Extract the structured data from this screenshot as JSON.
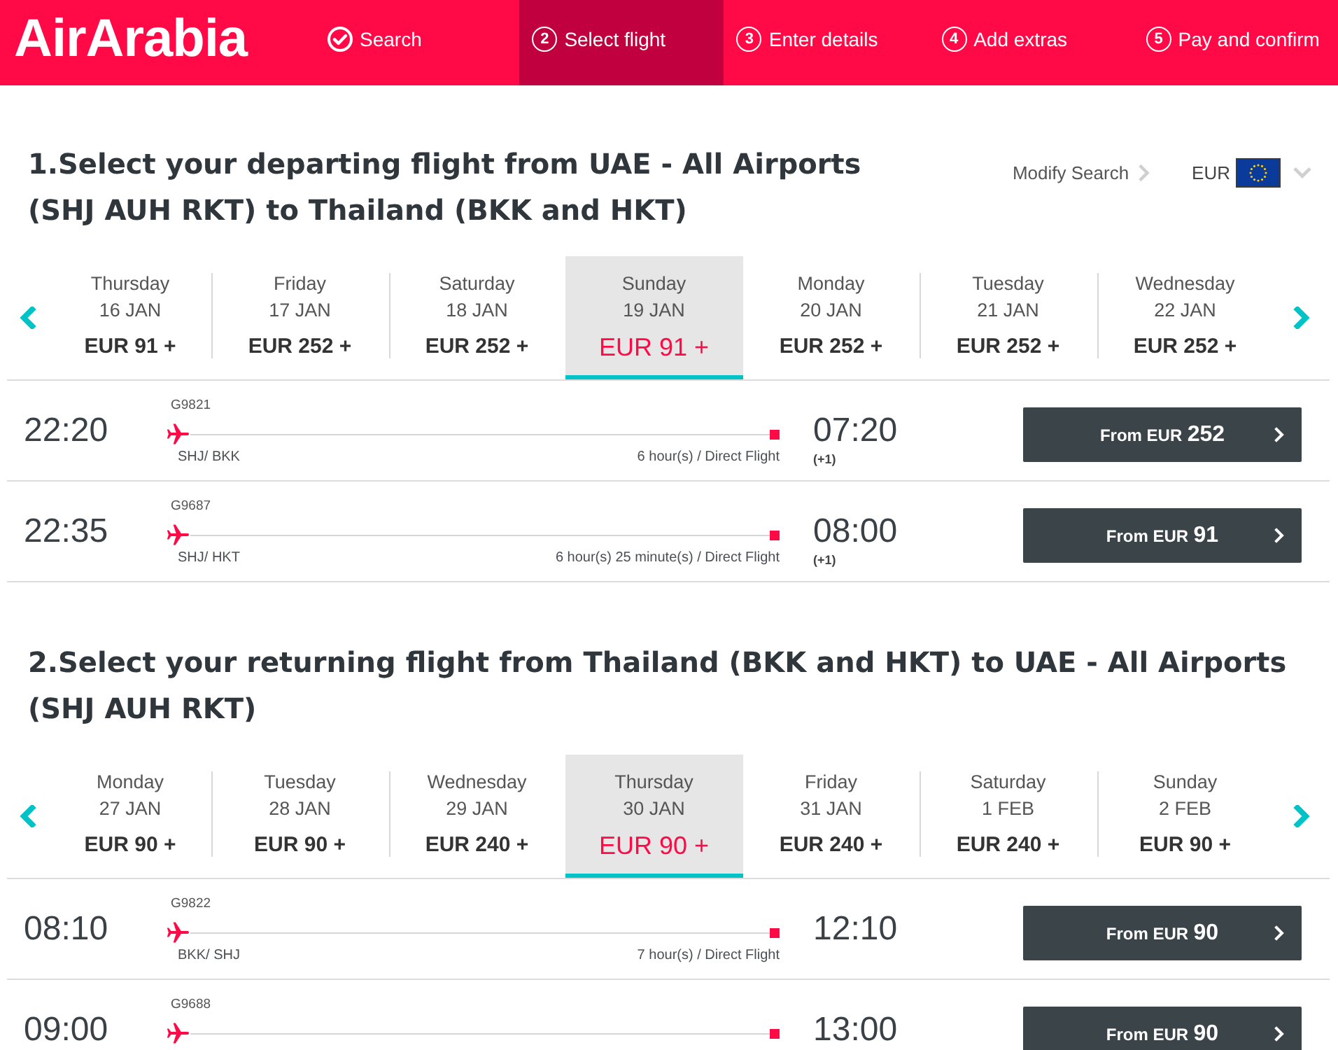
{
  "header": {
    "logo": "AirArabia",
    "steps": [
      {
        "label": "Search",
        "completed": true,
        "selected": false
      },
      {
        "number": "2",
        "label": "Select flight",
        "completed": false,
        "selected": true
      },
      {
        "number": "3",
        "label": "Enter details",
        "completed": false,
        "selected": false
      },
      {
        "number": "4",
        "label": "Add extras",
        "completed": false,
        "selected": false
      },
      {
        "number": "5",
        "label": "Pay and confirm",
        "completed": false,
        "selected": false
      }
    ]
  },
  "sections": [
    {
      "title": "1.Select your departing flight from UAE - All Airports (SHJ AUH RKT) to Thailand (BKK and HKT)",
      "modify_search": "Modify Search",
      "currency": "EUR",
      "dates": [
        {
          "day": "Thursday",
          "date": "16 JAN",
          "price": "EUR 91 +",
          "selected": false
        },
        {
          "day": "Friday",
          "date": "17 JAN",
          "price": "EUR 252 +",
          "selected": false
        },
        {
          "day": "Saturday",
          "date": "18 JAN",
          "price": "EUR 252 +",
          "selected": false
        },
        {
          "day": "Sunday",
          "date": "19 JAN",
          "price": "EUR 91 +",
          "selected": true
        },
        {
          "day": "Monday",
          "date": "20 JAN",
          "price": "EUR 252 +",
          "selected": false
        },
        {
          "day": "Tuesday",
          "date": "21 JAN",
          "price": "EUR 252 +",
          "selected": false
        },
        {
          "day": "Wednesday",
          "date": "22 JAN",
          "price": "EUR 252 +",
          "selected": false
        }
      ],
      "flights": [
        {
          "depart": "22:20",
          "flight_no": "G9821",
          "route": "SHJ/ BKK",
          "duration": "6 hour(s) / Direct Flight",
          "arrive": "07:20",
          "next_day": "(+1)",
          "fare_prefix": "From EUR",
          "fare_amount": "252"
        },
        {
          "depart": "22:35",
          "flight_no": "G9687",
          "route": "SHJ/ HKT",
          "duration": "6 hour(s) 25 minute(s) / Direct Flight",
          "arrive": "08:00",
          "next_day": "(+1)",
          "fare_prefix": "From EUR",
          "fare_amount": "91"
        }
      ]
    },
    {
      "title": "2.Select your returning flight from Thailand (BKK and HKT) to UAE - All Airports (SHJ AUH RKT)",
      "dates": [
        {
          "day": "Monday",
          "date": "27 JAN",
          "price": "EUR 90 +",
          "selected": false
        },
        {
          "day": "Tuesday",
          "date": "28 JAN",
          "price": "EUR 90 +",
          "selected": false
        },
        {
          "day": "Wednesday",
          "date": "29 JAN",
          "price": "EUR 240 +",
          "selected": false
        },
        {
          "day": "Thursday",
          "date": "30 JAN",
          "price": "EUR 90 +",
          "selected": true
        },
        {
          "day": "Friday",
          "date": "31 JAN",
          "price": "EUR 240 +",
          "selected": false
        },
        {
          "day": "Saturday",
          "date": "1 FEB",
          "price": "EUR 240 +",
          "selected": false
        },
        {
          "day": "Sunday",
          "date": "2 FEB",
          "price": "EUR 90 +",
          "selected": false
        }
      ],
      "flights": [
        {
          "depart": "08:10",
          "flight_no": "G9822",
          "route": "BKK/ SHJ",
          "duration": "7 hour(s) / Direct Flight",
          "arrive": "12:10",
          "fare_prefix": "From EUR",
          "fare_amount": "90"
        },
        {
          "depart": "09:00",
          "flight_no": "G9688",
          "arrive": "13:00",
          "fare_prefix": "From EUR",
          "fare_amount": "90"
        }
      ]
    }
  ]
}
